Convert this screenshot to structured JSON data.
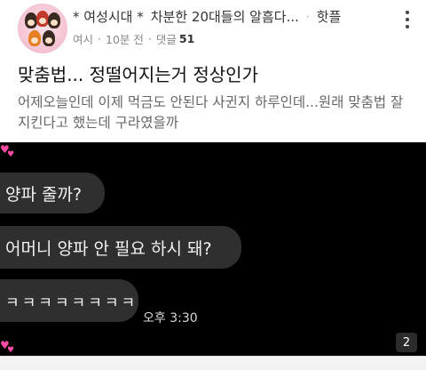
{
  "post": {
    "board_name": "* 여성시대 *",
    "snippet": "차분한 20대들의 알흠다...",
    "separator": "·",
    "channel": "핫플",
    "author": "여시",
    "time_ago": "10분 전",
    "meta_sep": "·",
    "comments_label": "댓글",
    "comments_count": "51",
    "title": "맞춤법... 정떨어지는거 정상인가",
    "body": "어제오늘인데 이제 먹금도 안된다 사귄지 하루인데...원래 맞춤법 잘 지킨다고 했는데 구라였을까"
  },
  "chat": {
    "messages": [
      {
        "text": "양파 줄까?"
      },
      {
        "text": "어머니 양파 안 필요 하시 돼?"
      },
      {
        "text": "ㅋㅋㅋㅋㅋㅋㅋㅋ"
      }
    ],
    "time": "오후 3:30",
    "page_number": "2",
    "heart_glyph": "♥"
  }
}
